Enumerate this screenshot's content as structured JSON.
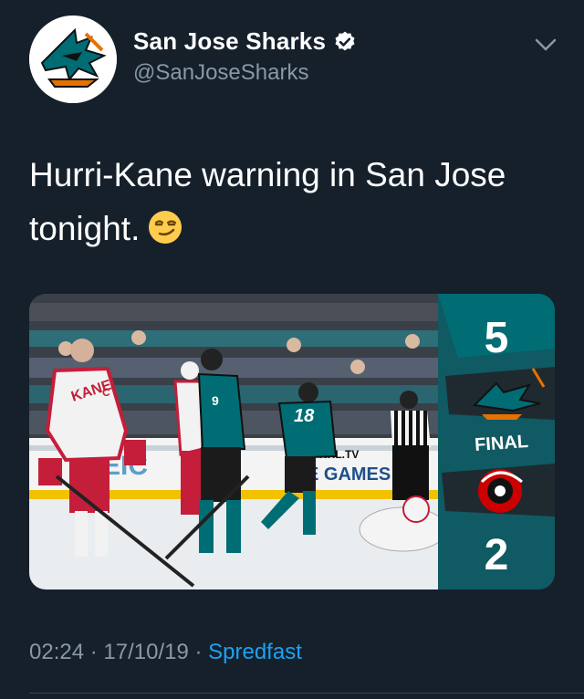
{
  "author": {
    "display_name": "San Jose Sharks",
    "handle": "@SanJoseSharks",
    "verified": true,
    "avatar_icon": "sharks-logo-icon"
  },
  "tweet": {
    "text_line1": "Hurri-Kane warning in San Jose",
    "text_line2": "tonight.",
    "emoji": "smirking-face-emoji"
  },
  "media": {
    "description_icon": "hockey-game-photo",
    "jersey_name": "KANE",
    "jersey_letter": "C",
    "jersey_number_teal1": "9",
    "jersey_number_teal2": "18",
    "board_text_1": "NHL.TV",
    "board_text_2": "E GAMES",
    "score_home": "5",
    "score_status": "FINAL",
    "score_away": "2",
    "colors": {
      "sharks_teal": "#006d75",
      "hurricanes_red": "#cc0000",
      "ice": "#e9edf0"
    }
  },
  "footer": {
    "time": "02:24",
    "separator1": " · ",
    "date": "17/10/19",
    "separator2": " · ",
    "source": "Spredfast"
  },
  "colors": {
    "background": "#15202b",
    "secondary_text": "#8899a6",
    "link": "#1da1f2"
  }
}
